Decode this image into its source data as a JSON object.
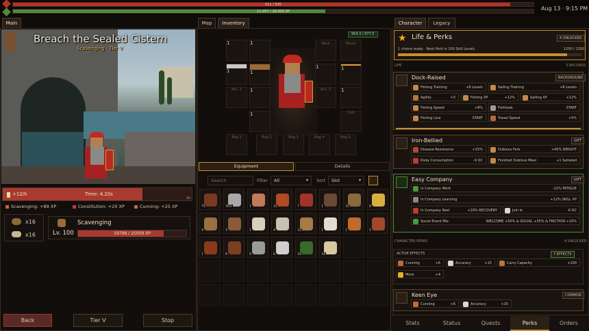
{
  "topbar": {
    "hp_text": "511 / 535",
    "xp_text": "11,057 / 18,400 XP",
    "hp_fraction": 0.955,
    "xp_fraction": 0.6,
    "datetime": "Aug 13 · 9:15 PM"
  },
  "main_tab": "Main",
  "activity": {
    "title": "Breach the Sealed Cistern",
    "subtitle": "Scavenging · Tier V",
    "rate": "+12/h",
    "time": "Time: 4.20s",
    "time_fraction": 0.74,
    "speed_tag": "2s",
    "rewards": [
      "Scavenging: +89 XP",
      "Constitution: +20 XP",
      "Cunning: +25 XP"
    ]
  },
  "resources": [
    {
      "count": "x16"
    },
    {
      "count": "x16"
    }
  ],
  "skill": {
    "name": "Scavenging",
    "level": "Lv. 100",
    "xp_text": "19796 / 25059 XP",
    "xp_fraction": 0.79
  },
  "buttons": {
    "back": "Back",
    "tier": "Tier V",
    "stop": "Stop"
  },
  "center_tabs": {
    "map": "Map",
    "inventory": "Inventory"
  },
  "weight": "954.3 / 977.5",
  "equipment": {
    "neck": "Neck",
    "mount": "Mount",
    "acc1": "Acc. 1",
    "acc2": "Acc. 2",
    "cart": "Cart",
    "bags": [
      "Bag 1",
      "Bag 2",
      "Bag 3",
      "Bag 4",
      "Bag 5"
    ],
    "slot_count": "1"
  },
  "subtabs": {
    "equipment": "Equipment",
    "details": "Details"
  },
  "filters": {
    "search_placeholder": "Search",
    "filter_label": "Filter",
    "filter_value": "All",
    "sort_label": "Sort",
    "sort_value": "Slot"
  },
  "inventory": [
    {
      "qty": "70",
      "color": "#7a3a22"
    },
    {
      "qty": "300",
      "color": "#a8a8a8"
    },
    {
      "qty": "1",
      "color": "#c07a5a"
    },
    {
      "qty": "10",
      "color": "#b04a22"
    },
    {
      "qty": "7",
      "color": "#a03428"
    },
    {
      "qty": "1",
      "color": "#6a4a32"
    },
    {
      "qty": "10",
      "color": "#8a6a3a"
    },
    {
      "qty": "8",
      "color": "#d8b040"
    },
    {
      "qty": "9",
      "color": "#9a7040"
    },
    {
      "qty": "3",
      "color": "#8a5a3a"
    },
    {
      "qty": "1",
      "color": "#d8d0b8"
    },
    {
      "qty": "4",
      "color": "#c8c0b0"
    },
    {
      "qty": "10",
      "color": "#a87a48"
    },
    {
      "qty": "1",
      "color": "#e0dcd0"
    },
    {
      "qty": "1",
      "color": "#c06a30"
    },
    {
      "qty": "5",
      "color": "#a04a2a"
    },
    {
      "qty": "1",
      "color": "#8a3a1a"
    },
    {
      "qty": "6",
      "color": "#7a4020"
    },
    {
      "qty": "6",
      "color": "#9a9a98"
    },
    {
      "qty": "6",
      "color": "#cfcfcf"
    },
    {
      "qty": "16",
      "color": "#3a6a2a"
    },
    {
      "qty": "16",
      "color": "#d8c8a0"
    }
  ],
  "right_tabs": {
    "character": "Character",
    "legacy": "Legacy"
  },
  "life_perks": {
    "title": "Life & Perks",
    "badge": "4 UNLOCKED",
    "subtitle": "1 choice ready · Next Perk in 100 Skill Levels",
    "progress": "1250 / 1350",
    "progress_fraction": 0.92
  },
  "life_label": "LIFE",
  "records_label": "3 RECORDS",
  "dock": {
    "title": "Dock-Raised",
    "badge": "BACKGROUND",
    "perks": [
      {
        "name": "Fishing Training",
        "value": "+8 Levels",
        "color": "#c08a4a"
      },
      {
        "name": "Sailing Training",
        "value": "+8 Levels",
        "color": "#c08a4a"
      },
      {
        "name": "Agility",
        "value": "+5",
        "color": "#b07a3a"
      },
      {
        "name": "Fishing XP",
        "value": "+12%",
        "color": "#c08a4a"
      },
      {
        "name": "Sailing XP",
        "value": "+12%",
        "color": "#c08a4a"
      },
      {
        "name": "Fishing Speed",
        "value": "+8%",
        "color": "#c08a4a"
      },
      {
        "name": "Fishhook",
        "value": "START",
        "color": "#9a9a98"
      },
      {
        "name": "Fishing Line",
        "value": "START",
        "color": "#c08a4a"
      },
      {
        "name": "Travel Speed",
        "value": "+5%",
        "color": "#b06a3a"
      }
    ]
  },
  "iron": {
    "title": "Iron-Bellied",
    "badge": "GIFT",
    "perks": [
      {
        "name": "Disease Resistance",
        "value": "+15%",
        "color": "#b04a2a"
      },
      {
        "name": "Dubious Fare",
        "value": "+45% WEIGHT",
        "color": "#c08a4a"
      },
      {
        "name": "Risky Consumption",
        "value": "-9 DC",
        "color": "#c03a3a"
      },
      {
        "name": "Finished Dubious Meal",
        "value": "+1 Satiated",
        "color": "#c08a4a"
      }
    ]
  },
  "easy": {
    "title": "Easy Company",
    "badge": "GIFT",
    "perks": [
      {
        "name": "In Company Work",
        "value": "-12% FATIGUE",
        "color": "#4a9a3a"
      },
      {
        "name": "In Company Learning",
        "value": "+12% SKILL XP",
        "color": "#8a8a8a"
      },
      {
        "name": "In Company Rest",
        "value": "+10% RECOVERY",
        "color": "#c03a3a"
      },
      {
        "name": "Join In",
        "value": "-6 DC",
        "color": "#d8d8d8"
      },
      {
        "name": "Social Event Mix",
        "value": "WELCOME +50% & SOCIAL +35% & FRICTION +10%",
        "color": "#4a9a3a"
      }
    ]
  },
  "character_perks": {
    "label": "CHARACTER PERKS",
    "count": "4 UNLOCKED"
  },
  "active_effects": {
    "label": "ACTIVE EFFECTS",
    "count": "7 EFFECTS",
    "items": [
      {
        "name": "Cunning",
        "value": "+6",
        "color": "#c06a3a"
      },
      {
        "name": "Accuracy",
        "value": "+15",
        "color": "#d8d8d8"
      },
      {
        "name": "Carry Capacity",
        "value": "+100",
        "color": "#b07a3a"
      },
      {
        "name": "More",
        "value": "+4",
        "color": "#e0b020"
      }
    ]
  },
  "keen": {
    "title": "Keen Eye",
    "badge": "COMMON",
    "perks": [
      {
        "name": "Cunning",
        "value": "+6",
        "color": "#c06a3a"
      },
      {
        "name": "Accuracy",
        "value": "+15",
        "color": "#d8d8d8"
      }
    ]
  },
  "bottom_tabs": [
    "Stats",
    "Status",
    "Quests",
    "Perks",
    "Orders"
  ]
}
